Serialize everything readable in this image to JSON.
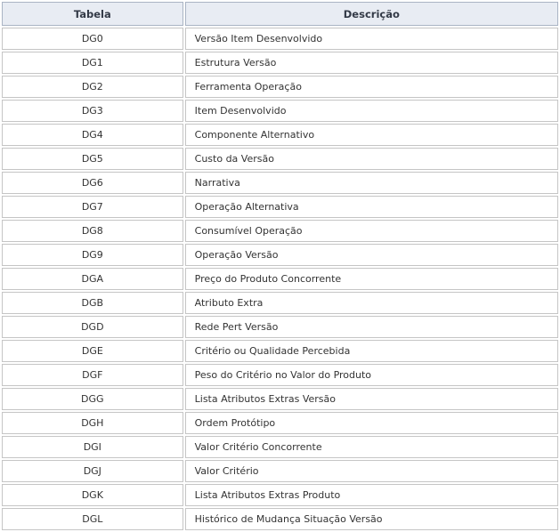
{
  "table": {
    "headers": [
      "Tabela",
      "Descrição"
    ],
    "rows": [
      {
        "tabela": "DG0",
        "descricao": "Versão Item Desenvolvido"
      },
      {
        "tabela": "DG1",
        "descricao": "Estrutura Versão"
      },
      {
        "tabela": "DG2",
        "descricao": "Ferramenta Operação"
      },
      {
        "tabela": "DG3",
        "descricao": "Item Desenvolvido"
      },
      {
        "tabela": "DG4",
        "descricao": "Componente Alternativo"
      },
      {
        "tabela": "DG5",
        "descricao": "Custo da Versão"
      },
      {
        "tabela": "DG6",
        "descricao": "Narrativa"
      },
      {
        "tabela": "DG7",
        "descricao": "Operação Alternativa"
      },
      {
        "tabela": "DG8",
        "descricao": "Consumível Operação"
      },
      {
        "tabela": "DG9",
        "descricao": "Operação Versão"
      },
      {
        "tabela": "DGA",
        "descricao": "Preço do Produto Concorrente"
      },
      {
        "tabela": "DGB",
        "descricao": "Atributo Extra"
      },
      {
        "tabela": "DGD",
        "descricao": "Rede Pert Versão"
      },
      {
        "tabela": "DGE",
        "descricao": "Critério ou Qualidade Percebida"
      },
      {
        "tabela": "DGF",
        "descricao": "Peso do Critério no Valor do Produto"
      },
      {
        "tabela": "DGG",
        "descricao": "Lista Atributos Extras Versão"
      },
      {
        "tabela": "DGH",
        "descricao": "Ordem Protótipo"
      },
      {
        "tabela": "DGI",
        "descricao": "Valor Critério Concorrente"
      },
      {
        "tabela": "DGJ",
        "descricao": "Valor Critério"
      },
      {
        "tabela": "DGK",
        "descricao": "Lista Atributos Extras Produto"
      },
      {
        "tabela": "DGL",
        "descricao": "Histórico de Mudança Situação Versão"
      }
    ]
  }
}
